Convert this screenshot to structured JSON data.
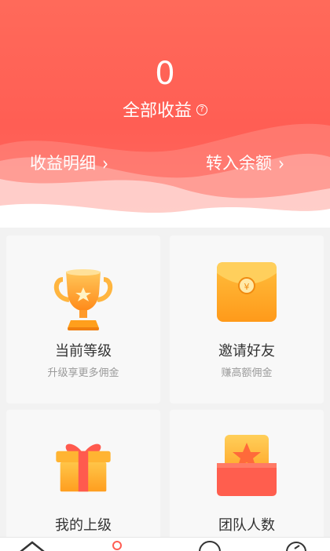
{
  "summary": {
    "total_amount": "0",
    "total_label": "全部收益",
    "help_symbol": "?"
  },
  "header_links": {
    "income_detail": "收益明细",
    "transfer_balance": "转入余额",
    "chevron": "›"
  },
  "cards": [
    {
      "title": "当前等级",
      "subtitle": "升级享更多佣金",
      "icon": "trophy-icon"
    },
    {
      "title": "邀请好友",
      "subtitle": "赚高额佣金",
      "icon": "red-envelope-icon"
    },
    {
      "title": "我的上级",
      "subtitle": "",
      "icon": "gift-box-icon"
    },
    {
      "title": "团队人数",
      "subtitle": "",
      "icon": "star-card-icon"
    }
  ],
  "bottom_nav": [
    {
      "icon": "home-icon"
    },
    {
      "icon": "people-icon"
    },
    {
      "icon": "message-icon"
    },
    {
      "icon": "profile-icon"
    }
  ],
  "colors": {
    "header_red": "#ff5e54",
    "accent_orange": "#ff9f1c",
    "text_dark": "#333333",
    "text_gray": "#9a9a9a"
  }
}
